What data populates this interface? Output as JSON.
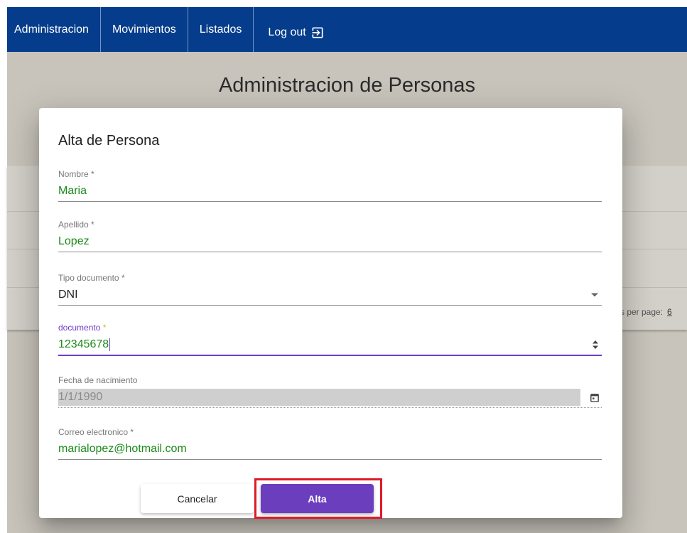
{
  "nav": {
    "items": [
      {
        "label": "Administracion"
      },
      {
        "label": "Movimientos"
      },
      {
        "label": "Listados"
      }
    ],
    "logout_label": "Log out",
    "logout_icon": "logout-icon"
  },
  "page": {
    "title": "Administracion de Personas",
    "rows_per_page_label": "s per page:",
    "rows_per_page_value": "6"
  },
  "dialog": {
    "title": "Alta de Persona",
    "fields": {
      "nombre": {
        "label": "Nombre",
        "required": "*",
        "value": "Maria"
      },
      "apellido": {
        "label": "Apellido",
        "required": "*",
        "value": "Lopez"
      },
      "tipo_documento": {
        "label": "Tipo documento",
        "required": "*",
        "value": "DNI"
      },
      "documento": {
        "label": "documento",
        "required": "*",
        "value": "12345678"
      },
      "fecha_nacimiento": {
        "label": "Fecha de nacimiento",
        "value": "1/1/1990"
      },
      "correo": {
        "label": "Correo electronico",
        "required": "*",
        "value": "marialopez@hotmail.com"
      }
    },
    "cancel_label": "Cancelar",
    "submit_label": "Alta"
  },
  "colors": {
    "navbar": "#053d8c",
    "accent": "#6a3ebd",
    "value_text": "#1a8a1a",
    "highlight": "#e0192a"
  }
}
